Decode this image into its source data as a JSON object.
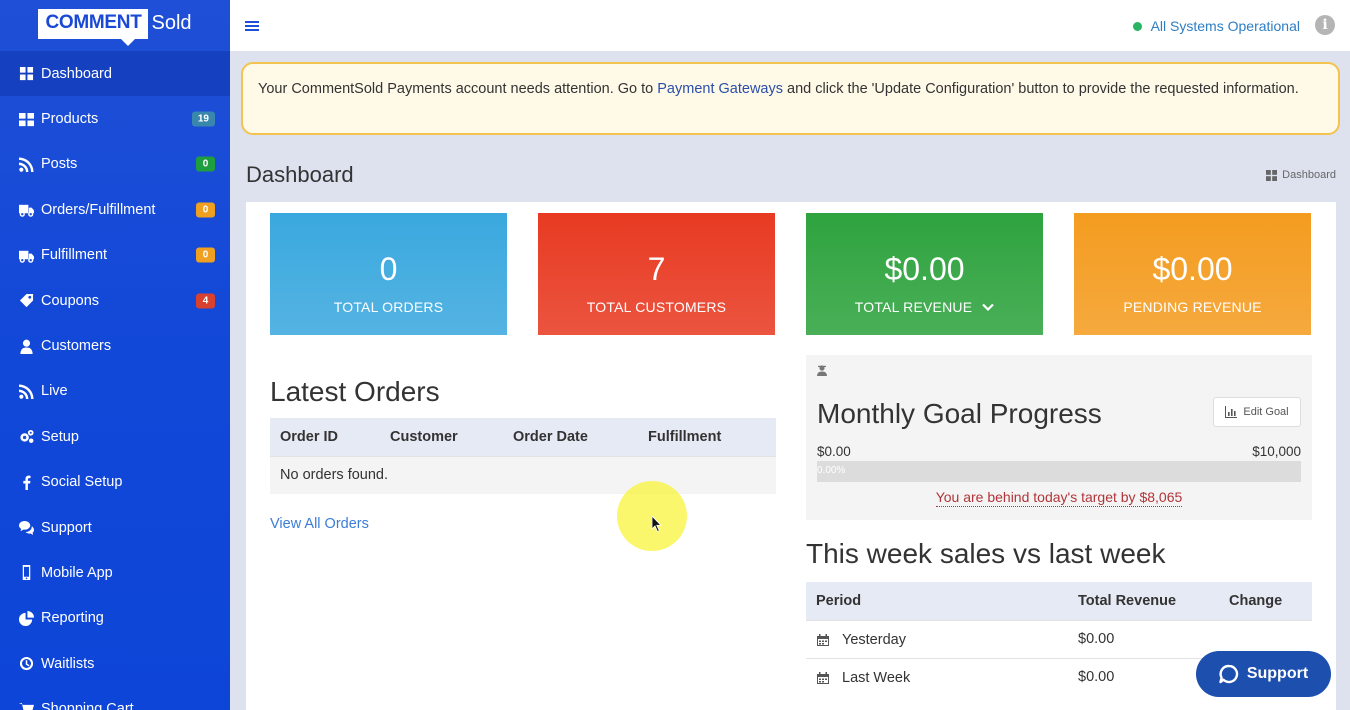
{
  "logo": {
    "comment": "COMMENT",
    "sold": "Sold"
  },
  "sidebar": {
    "items": [
      {
        "label": "Dashboard",
        "icon": "dashboard-icon",
        "badge": null,
        "active": true
      },
      {
        "label": "Products",
        "icon": "grid-icon",
        "badge": "19",
        "badge_color": "#3a87ad"
      },
      {
        "label": "Posts",
        "icon": "rss-icon",
        "badge": "0",
        "badge_color": "#1e9e3e"
      },
      {
        "label": "Orders/Fulfillment",
        "icon": "truck-icon",
        "badge": "0",
        "badge_color": "#f0a020"
      },
      {
        "label": "Fulfillment",
        "icon": "truck-icon",
        "badge": "0",
        "badge_color": "#f0a020"
      },
      {
        "label": "Coupons",
        "icon": "tag-icon",
        "badge": "4",
        "badge_color": "#d9412f"
      },
      {
        "label": "Customers",
        "icon": "user-icon",
        "badge": null
      },
      {
        "label": "Live",
        "icon": "rss-icon",
        "badge": null
      },
      {
        "label": "Setup",
        "icon": "gears-icon",
        "badge": null
      },
      {
        "label": "Social Setup",
        "icon": "facebook-icon",
        "badge": null
      },
      {
        "label": "Support",
        "icon": "chat-icon",
        "badge": null
      },
      {
        "label": "Mobile App",
        "icon": "mobile-icon",
        "badge": null
      },
      {
        "label": "Reporting",
        "icon": "pie-chart-icon",
        "badge": null
      },
      {
        "label": "Waitlists",
        "icon": "clock-icon",
        "badge": null
      },
      {
        "label": "Shopping Cart",
        "icon": "cart-icon",
        "badge": null
      }
    ]
  },
  "topbar": {
    "status": "All Systems Operational",
    "status_color": "#28b463"
  },
  "alert": {
    "text_before": "Your CommentSold Payments account needs attention. Go to ",
    "link": "Payment Gateways",
    "text_after": " and click the 'Update Configuration' button to provide the requested information."
  },
  "page": {
    "title": "Dashboard",
    "breadcrumb": "Dashboard"
  },
  "stats": [
    {
      "value": "0",
      "label": "TOTAL ORDERS",
      "color": "#3aa8de"
    },
    {
      "value": "7",
      "label": "TOTAL CUSTOMERS",
      "color": "#e83a22"
    },
    {
      "value": "$0.00",
      "label": "TOTAL REVENUE",
      "color": "#2ea33e"
    },
    {
      "value": "$0.00",
      "label": "PENDING REVENUE",
      "color": "#f49c20"
    }
  ],
  "latest_orders": {
    "title": "Latest Orders",
    "columns": [
      "Order ID",
      "Customer",
      "Order Date",
      "Fulfillment"
    ],
    "empty": "No orders found.",
    "view_all": "View All Orders"
  },
  "goal": {
    "title": "Monthly Goal Progress",
    "edit_label": "Edit Goal",
    "min": "$0.00",
    "max": "$10,000",
    "progress_text": "0.00%",
    "progress": 0,
    "behind_text": "You are behind today's target by $8,065"
  },
  "week_sales": {
    "title": "This week sales vs last week",
    "columns": [
      "Period",
      "Total Revenue",
      "Change"
    ],
    "rows": [
      {
        "period": "Yesterday",
        "revenue": "$0.00",
        "change": ""
      },
      {
        "period": "Last Week",
        "revenue": "$0.00",
        "change": ""
      }
    ]
  },
  "support_button": "Support"
}
